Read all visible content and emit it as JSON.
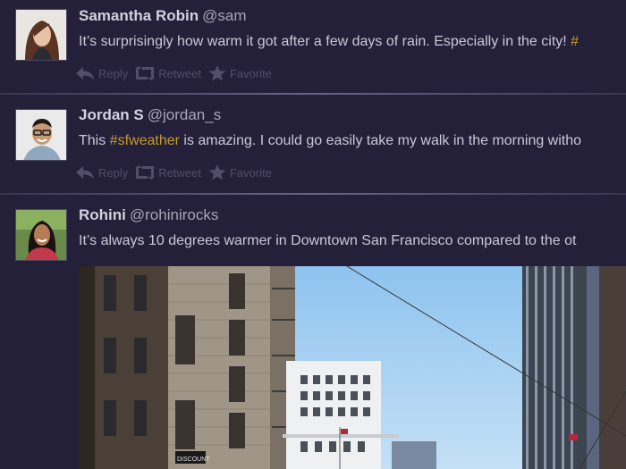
{
  "actions": {
    "reply": "Reply",
    "retweet": "Retweet",
    "favorite": "Favorite"
  },
  "tweets": [
    {
      "name": "Samantha Robin",
      "handle": "@sam",
      "text_before": "It’s surprisingly how warm it got after a few days of rain. Especially in the city! ",
      "hashtag": "#",
      "text_after": ""
    },
    {
      "name": "Jordan S",
      "handle": "@jordan_s",
      "text_before": "This ",
      "hashtag": "#sfweather",
      "text_after": " is amazing. I could go easily take my walk in the morning witho"
    },
    {
      "name": "Rohini",
      "handle": "@rohinirocks",
      "text_before": "It’s always 10 degrees warmer in Downtown San Francisco compared to the ot",
      "hashtag": "",
      "text_after": ""
    }
  ],
  "colors": {
    "background": "#24203a",
    "name": "#d4d1df",
    "handle": "#a8a4b8",
    "body": "#cbc7d6",
    "hashtag": "#c49a2a",
    "action": "#524d69"
  },
  "photo": {
    "sign_text": "DISCOUNT"
  }
}
